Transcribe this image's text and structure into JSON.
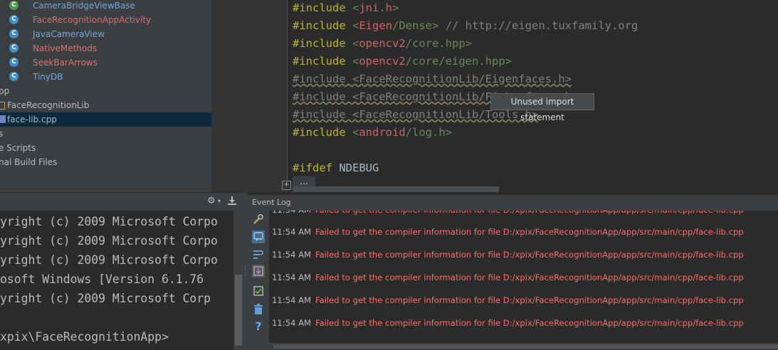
{
  "project_tree": {
    "items": [
      {
        "label": "CameraBridgeViewBase",
        "icon": "class-icon-enum"
      },
      {
        "label": "FaceRecognitionAppActivity",
        "icon": "class-icon"
      },
      {
        "label": "JavaCameraView",
        "icon": "class-icon"
      },
      {
        "label": "NativeMethods",
        "icon": "class-icon"
      },
      {
        "label": "SeekBarArrows",
        "icon": "class-icon"
      },
      {
        "label": "TinyDB",
        "icon": "class-icon"
      },
      {
        "label": "pp",
        "icon": "none"
      },
      {
        "label": "FaceRecognitionLib",
        "icon": "folder-icon"
      },
      {
        "label": "face-lib.cpp",
        "icon": "cpp-file-icon"
      },
      {
        "label": "s",
        "icon": "none"
      },
      {
        "label": "e Scripts",
        "icon": "none"
      },
      {
        "label": "nal Build Files",
        "icon": "none"
      }
    ]
  },
  "editor": {
    "lines": [
      {
        "directive": "#include",
        "open": "<",
        "path_a": "jni.h",
        "path_b": "",
        "close": ">",
        "comment": ""
      },
      {
        "directive": "#include",
        "open": "<",
        "path_a": "Eigen",
        "path_b": "/Dense",
        "close": ">",
        "comment": " // http://eigen.tuxfamily.org"
      },
      {
        "directive": "#include",
        "open": "<",
        "path_a": "opencv2",
        "path_b": "/core.hpp",
        "close": ">",
        "comment": ""
      },
      {
        "directive": "#include",
        "open": "<",
        "path_a": "opencv2",
        "path_b": "/core/eigen.hpp",
        "close": ">",
        "comment": ""
      },
      {
        "text": "#include <FaceRecognitionLib/Eigenfaces.h>"
      },
      {
        "text": "#include <FaceRecognitionLib/Fisherfaces.h>"
      },
      {
        "text": "#include <FaceRecognitionLib/Tools.h>"
      },
      {
        "directive": "#include",
        "open": "<",
        "path_a": "android",
        "path_b": "/log.h",
        "close": ">",
        "comment": ""
      },
      {
        "directive": "#ifdef",
        "arg": " NDEBUG"
      }
    ],
    "tooltip": "Unused import statement",
    "fold_placeholder": "...",
    "fold_toggle": "+"
  },
  "terminal": {
    "lines": [
      "yright (c) 2009 Microsoft Corpo",
      "yright (c) 2009 Microsoft Corpo",
      "yright (c) 2009 Microsoft Corpo",
      "osoft Windows [Version 6.1.76",
      "yright (c) 2009 Microsoft Corp",
      "",
      "xpix\\FaceRecognitionApp>"
    ]
  },
  "event_log": {
    "title": "Event Log",
    "partial_row": {
      "time": "11:54 AM",
      "message": "Failed to get the compiler information for file D:/xpix/FaceRecognitionApp/app/src/main/cpp/face-lib.cpp"
    },
    "rows": [
      {
        "time": "11:54 AM",
        "message": "Failed to get the compiler information for file D:/xpix/FaceRecognitionApp/app/src/main/cpp/face-lib.cpp"
      },
      {
        "time": "11:54 AM",
        "message": "Failed to get the compiler information for file D:/xpix/FaceRecognitionApp/app/src/main/cpp/face-lib.cpp"
      },
      {
        "time": "11:54 AM",
        "message": "Failed to get the compiler information for file D:/xpix/FaceRecognitionApp/app/src/main/cpp/face-lib.cpp"
      },
      {
        "time": "11:54 AM",
        "message": "Failed to get the compiler information for file D:/xpix/FaceRecognitionApp/app/src/main/cpp/face-lib.cpp"
      },
      {
        "time": "11:54 AM",
        "message": "Failed to get the compiler information for file D:/xpix/FaceRecognitionApp/app/src/main/cpp/face-lib.cpp"
      },
      {
        "time": "11:54 AM",
        "message": "Failed to get the compiler information for file D:/xpix/FaceRecognitionApp/app/src/main/cpp/face-lib.cpp"
      }
    ],
    "toolbar_icons": [
      "settings-icon",
      "balloon-icon",
      "soft-wrap-icon",
      "scroll-to-end-icon",
      "mark-all-read-icon",
      "trash-icon",
      "help-icon"
    ],
    "help_glyph": "?"
  },
  "colors": {
    "error": "#ff6b68",
    "selection": "#0d293e",
    "panel": "#3c3f41",
    "editor_bg": "#2b2b2b"
  }
}
